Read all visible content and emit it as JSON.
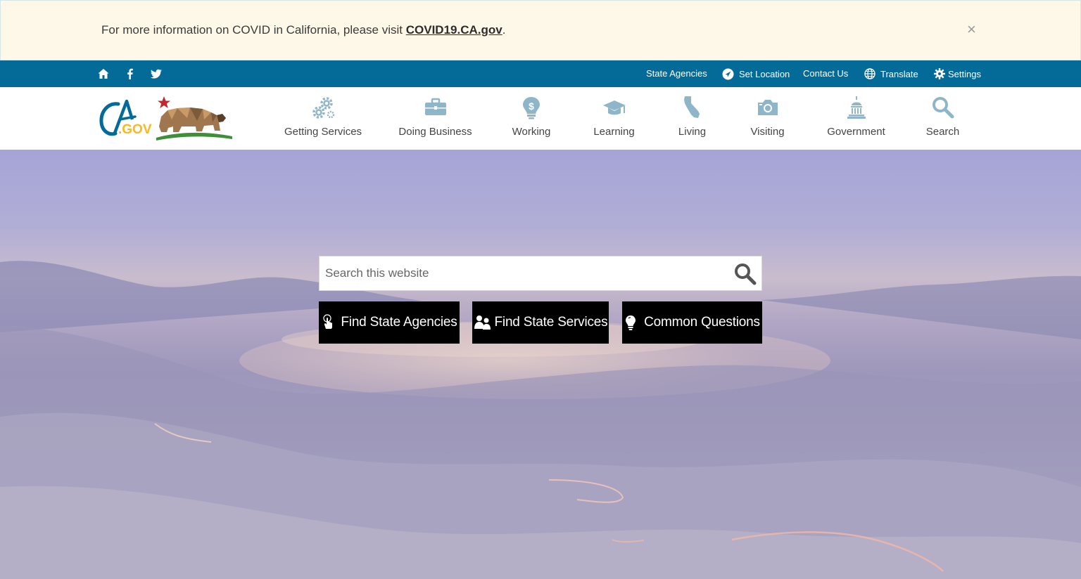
{
  "alert": {
    "text": "For more information on COVID in California, please visit ",
    "link": "COVID19.CA.gov",
    "suffix": ".",
    "close": "×"
  },
  "utility": {
    "links": {
      "state_agencies": "State Agencies",
      "set_location": "Set Location",
      "contact_us": "Contact Us",
      "translate": "Translate",
      "settings": "Settings"
    }
  },
  "nav": {
    "items": [
      {
        "label": "Getting Services",
        "icon": "gears-icon"
      },
      {
        "label": "Doing Business",
        "icon": "briefcase-icon"
      },
      {
        "label": "Working",
        "icon": "lightbulb-dollar-icon"
      },
      {
        "label": "Learning",
        "icon": "graduation-cap-icon"
      },
      {
        "label": "Living",
        "icon": "california-icon"
      },
      {
        "label": "Visiting",
        "icon": "camera-icon"
      },
      {
        "label": "Government",
        "icon": "capitol-icon"
      },
      {
        "label": "Search",
        "icon": "search-icon"
      }
    ]
  },
  "hero": {
    "search_placeholder": "Search this website",
    "buttons": {
      "agencies": "Find State Agencies",
      "services": "Find State Services",
      "questions": "Common Questions"
    }
  },
  "colors": {
    "utility_bar": "#046b99",
    "nav_icon": "#8fb5c9",
    "alert_bg": "#fef8e8"
  }
}
